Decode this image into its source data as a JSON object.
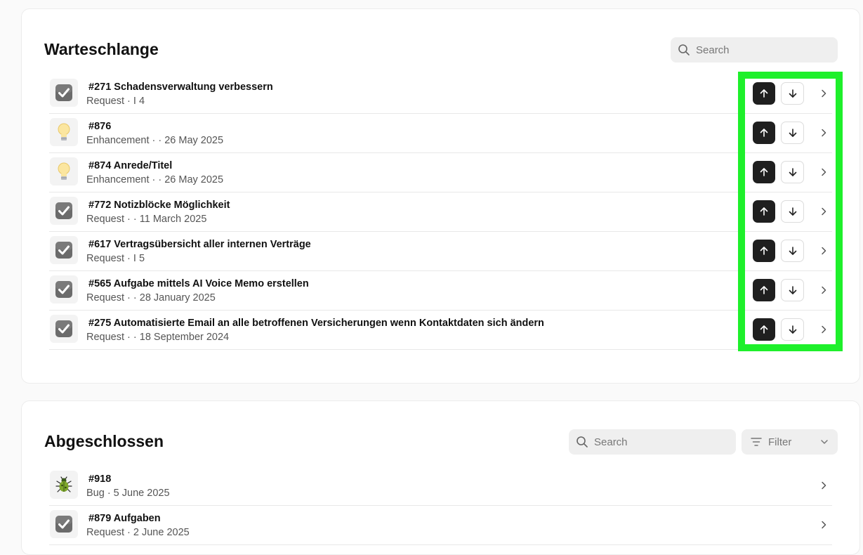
{
  "queue": {
    "title": "Warteschlange",
    "search_placeholder": "Search",
    "items": [
      {
        "icon": "check-icon",
        "title": "#271 Schadensverwaltung verbessern",
        "meta": "Request · I                                  4"
      },
      {
        "icon": "lightbulb-icon",
        "title": "#876",
        "meta": "Enhancement ·   · 26 May 2025"
      },
      {
        "icon": "lightbulb-icon",
        "title": "#874 Anrede/Titel",
        "meta": "Enhancement ·   · 26 May 2025"
      },
      {
        "icon": "check-icon",
        "title": "#772 Notizblöcke Möglichkeit",
        "meta": "Request ·   · 11 March 2025"
      },
      {
        "icon": "check-icon",
        "title": "#617 Vertragsübersicht aller internen Verträge",
        "meta": "Request · I                          5"
      },
      {
        "icon": "check-icon",
        "title": "#565 Aufgabe mittels AI Voice Memo erstellen",
        "meta": "Request ·   · 28 January 2025"
      },
      {
        "icon": "check-icon",
        "title": "#275 Automatisierte Email an alle betroffenen Versicherungen wenn Kontaktdaten sich ändern",
        "meta": "Request ·   · 18 September 2024"
      }
    ]
  },
  "done": {
    "title": "Abgeschlossen",
    "search_placeholder": "Search",
    "filter_label": "Filter",
    "items": [
      {
        "icon": "bug-icon",
        "title": "#918",
        "meta": "Bug · 5 June 2025"
      },
      {
        "icon": "check-icon",
        "title": "#879 Aufgaben",
        "meta": "Request · 2 June 2025"
      }
    ]
  },
  "colors": {
    "highlight": "#1ef02b",
    "up_button": "#1f1f1f"
  }
}
